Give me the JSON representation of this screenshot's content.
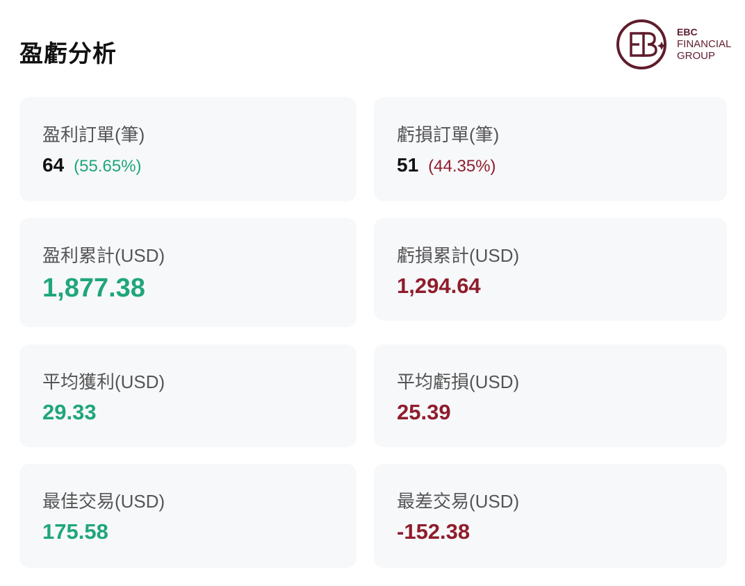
{
  "header": {
    "title": "盈虧分析",
    "logo": {
      "line1": "EBC",
      "line2": "FINANCIAL",
      "line3": "GROUP",
      "color": "#5e1d2c"
    }
  },
  "colors": {
    "profit": "#1fa67a",
    "loss": "#8f1d2c",
    "card_bg": "#f7f8fa"
  },
  "cards": {
    "profit_orders": {
      "label": "盈利訂單(筆)",
      "count": "64",
      "percent": "(55.65%)"
    },
    "loss_orders": {
      "label": "虧損訂單(筆)",
      "count": "51",
      "percent": "(44.35%)"
    },
    "profit_total": {
      "label": "盈利累計(USD)",
      "value": "1,877.38"
    },
    "loss_total": {
      "label": "虧損累計(USD)",
      "value": "1,294.64"
    },
    "avg_profit": {
      "label": "平均獲利(USD)",
      "value": "29.33"
    },
    "avg_loss": {
      "label": "平均虧損(USD)",
      "value": "25.39"
    },
    "best_trade": {
      "label": "最佳交易(USD)",
      "value": "175.58"
    },
    "worst_trade": {
      "label": "最差交易(USD)",
      "value": "-152.38"
    }
  }
}
